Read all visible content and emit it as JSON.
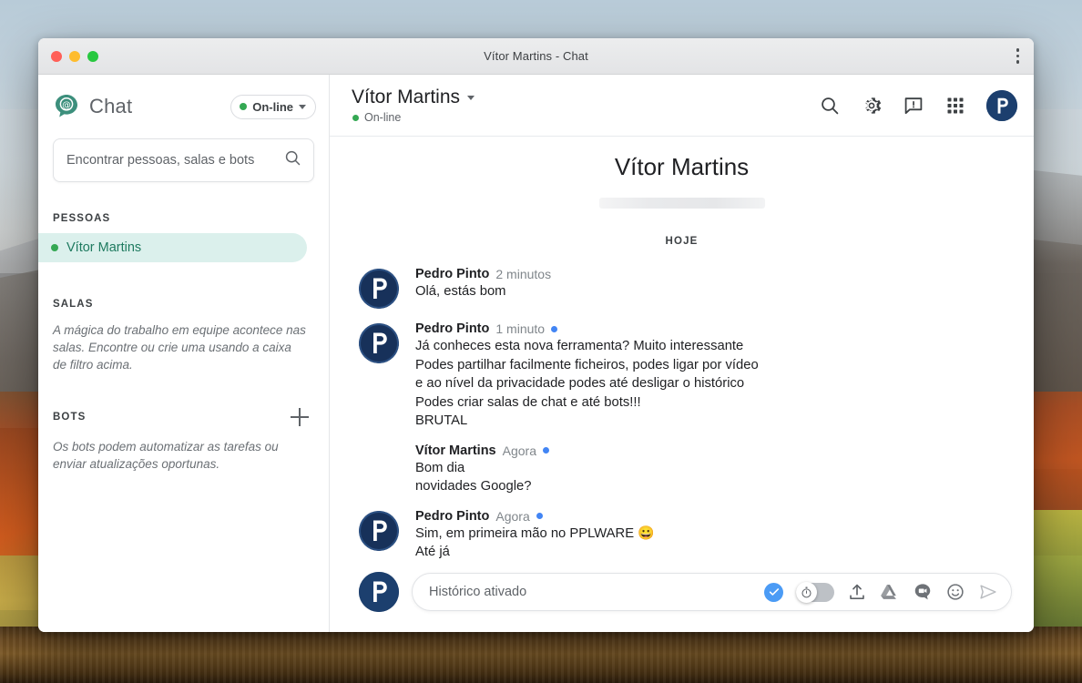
{
  "window": {
    "title": "Vítor Martins - Chat",
    "traffic_lights": [
      "close",
      "minimize",
      "zoom"
    ],
    "overflow_menu": "more-options"
  },
  "sidebar": {
    "brand": "Chat",
    "logo_icon": "chat-at-bubble-icon",
    "status": {
      "label": "On-line",
      "color": "#34a853"
    },
    "search": {
      "placeholder": "Encontrar pessoas, salas e bots",
      "value": "",
      "icon": "search-icon"
    },
    "sections": {
      "people": {
        "label": "PESSOAS",
        "items": [
          {
            "name": "Vítor Martins",
            "status_color": "#34a853",
            "selected": true
          }
        ]
      },
      "rooms": {
        "label": "SALAS",
        "hint": "A mágica do trabalho em equipe acontece nas salas. Encontre ou crie uma usando a caixa de filtro acima."
      },
      "bots": {
        "label": "BOTS",
        "add_icon": "plus-icon",
        "hint": "Os bots podem automatizar as tarefas ou enviar atualizações oportunas."
      }
    }
  },
  "header": {
    "name": "Vítor Martins",
    "dropdown_icon": "chevron-down-icon",
    "status": "On-line",
    "icons": [
      "search-icon",
      "gear-icon",
      "feedback-icon",
      "apps-grid-icon"
    ],
    "avatar": {
      "initial": "P",
      "color": "#1c3f6e"
    }
  },
  "conversation": {
    "title": "Vítor Martins",
    "day_separator": "HOJE",
    "messages": [
      {
        "author": "Pedro Pinto",
        "time": "2 minutos",
        "unread": false,
        "avatar": "pedro",
        "lines": [
          "Olá, estás bom"
        ]
      },
      {
        "author": "Pedro Pinto",
        "time": "1 minuto",
        "unread": true,
        "avatar": "pedro",
        "lines": [
          "Já conheces esta nova ferramenta? Muito interessante",
          "Podes partilhar facilmente ficheiros, podes ligar por vídeo",
          "e ao nível da privacidade podes até desligar o histórico",
          "Podes criar salas de chat e até bots!!!",
          "BRUTAL"
        ]
      },
      {
        "author": "Vítor Martins",
        "time": "Agora",
        "unread": true,
        "avatar": "vitor",
        "lines": [
          "Bom dia",
          "novidades Google?"
        ]
      },
      {
        "author": "Pedro Pinto",
        "time": "Agora",
        "unread": true,
        "avatar": "pedro",
        "lines": [
          "Sim, em primeira mão no PPLWARE 😀",
          "Até já"
        ]
      }
    ]
  },
  "composer": {
    "avatar": {
      "initial": "P",
      "color": "#1c3f6e"
    },
    "placeholder": "Histórico ativado",
    "value": "",
    "icons": [
      "check-circle-icon",
      "history-toggle-icon",
      "upload-icon",
      "google-drive-icon",
      "meet-video-icon",
      "emoji-icon",
      "send-icon"
    ],
    "history_toggle_state": "off",
    "check_color": "#4b9bf5"
  }
}
